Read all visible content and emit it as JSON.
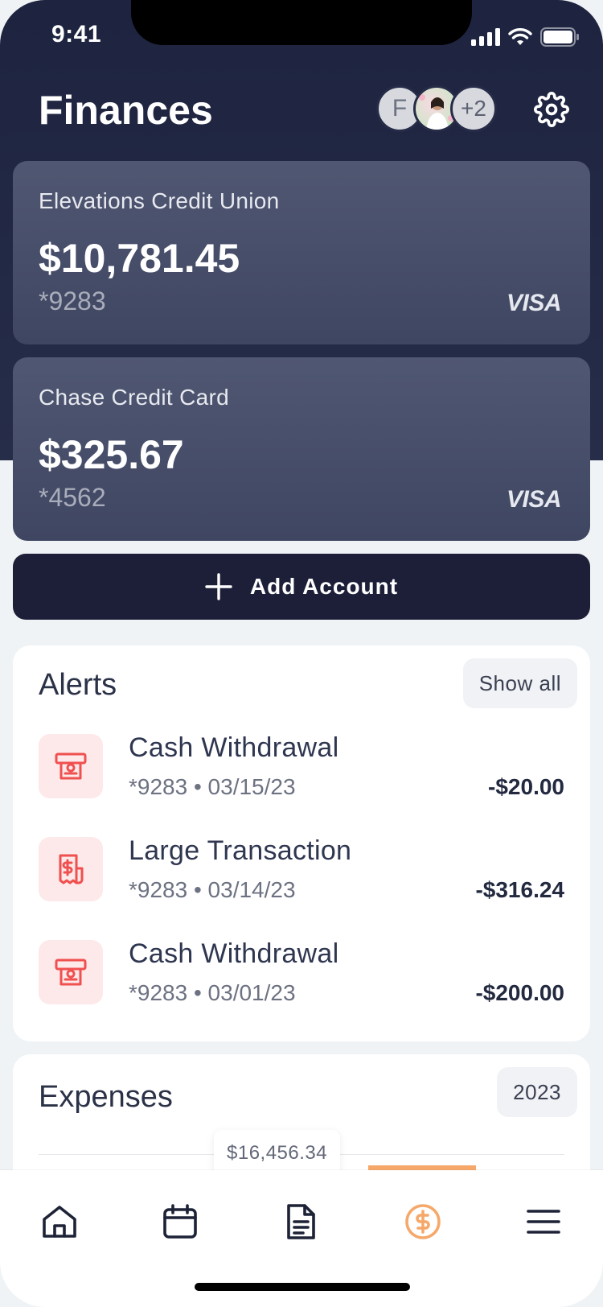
{
  "status_bar": {
    "time": "9:41"
  },
  "header": {
    "title": "Finances",
    "avatars": [
      {
        "initial": "F"
      },
      {
        "initial": ""
      },
      {
        "initial": "+2"
      }
    ]
  },
  "accounts": [
    {
      "name": "Elevations Credit Union",
      "balance": "$10,781.45",
      "number": "*9283",
      "network": "VISA"
    },
    {
      "name": "Chase Credit Card",
      "balance": "$325.67",
      "number": "*4562",
      "network": "VISA"
    }
  ],
  "add_account": {
    "label": "Add Account"
  },
  "alerts": {
    "title": "Alerts",
    "show_all": "Show all",
    "items": [
      {
        "title": "Cash Withdrawal",
        "subtitle": "*9283 • 03/15/23",
        "amount": "-$20.00",
        "icon": "atm-cash-icon"
      },
      {
        "title": "Large Transaction",
        "subtitle": "*9283 • 03/14/23",
        "amount": "-$316.24",
        "icon": "receipt-dollar-icon"
      },
      {
        "title": "Cash Withdrawal",
        "subtitle": "*9283 • 03/01/23",
        "amount": "-$200.00",
        "icon": "atm-cash-icon"
      }
    ]
  },
  "expenses": {
    "title": "Expenses",
    "year": "2023",
    "tooltip": "$16,456.34"
  },
  "tabbar": {
    "items": [
      {
        "icon": "home-icon",
        "active": false
      },
      {
        "icon": "calendar-icon",
        "active": false
      },
      {
        "icon": "document-icon",
        "active": false
      },
      {
        "icon": "dollar-circle-icon",
        "active": true
      },
      {
        "icon": "menu-icon",
        "active": false
      }
    ]
  },
  "colors": {
    "hero": "#1e2440",
    "card": "#4a5069",
    "primary_button": "#1d1f38",
    "alert_icon_bg": "#fde9e9",
    "alert_icon": "#f0504f",
    "accent": "#f6a86a"
  }
}
